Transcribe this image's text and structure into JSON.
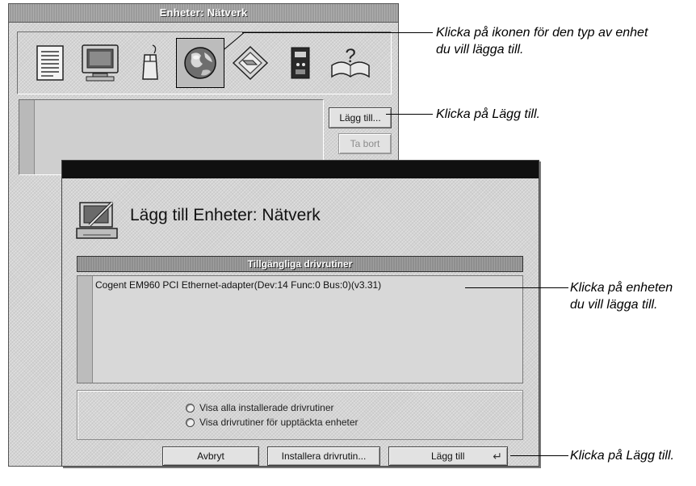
{
  "back_window": {
    "title": "Enheter: Nätverk",
    "icons": [
      "document-icon",
      "monitor-icon",
      "mouse-icon",
      "globe-network-icon",
      "drive-diamond-icon",
      "modem-icon",
      "help-book-icon"
    ],
    "add_button": "Lägg till...",
    "remove_button": "Ta bort"
  },
  "dialog": {
    "title": "Lägg till Enheter: Nätverk",
    "list_header": "Tillgängliga drivrutiner",
    "drivers": [
      "Cogent EM960 PCI Ethernet-adapter(Dev:14 Func:0 Bus:0)(v3.31)"
    ],
    "options": [
      "Visa alla installerade drivrutiner",
      "Visa drivrutiner för upptäckta enheter"
    ],
    "cancel_button": "Avbryt",
    "install_button": "Installera drivrutin...",
    "add_button": "Lägg till"
  },
  "callouts": {
    "icon": [
      "Klicka på ikonen för den typ av enhet",
      "du vill lägga till."
    ],
    "add1": "Klicka på Lägg till.",
    "device": [
      "Klicka på enheten",
      "du vill lägga till."
    ],
    "add2": "Klicka på Lägg till."
  }
}
